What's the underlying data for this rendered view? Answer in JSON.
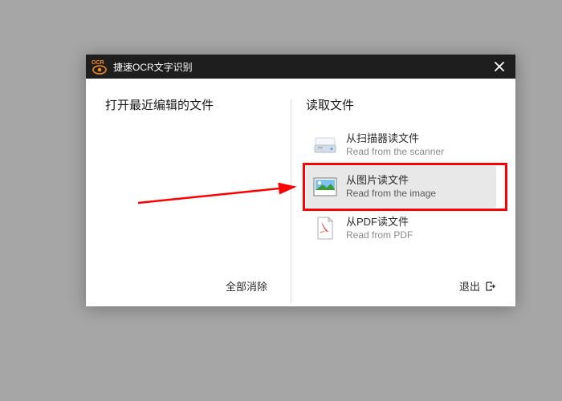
{
  "titlebar": {
    "logo_text": "OCR",
    "title": "捷速OCR文字识别"
  },
  "left": {
    "header": "打开最近编辑的文件",
    "clear_all": "全部消除"
  },
  "right": {
    "header": "读取文件",
    "options": [
      {
        "title": "从扫描器读文件",
        "sub": "Read from the scanner"
      },
      {
        "title": "从图片读文件",
        "sub": "Read from the image"
      },
      {
        "title": "从PDF读文件",
        "sub": "Read from PDF"
      }
    ],
    "exit_label": "退出"
  },
  "icons": {
    "close": "close-icon",
    "scanner": "scanner-icon",
    "image": "image-icon",
    "pdf": "pdf-icon",
    "exit": "exit-icon",
    "eye": "eye-icon"
  }
}
